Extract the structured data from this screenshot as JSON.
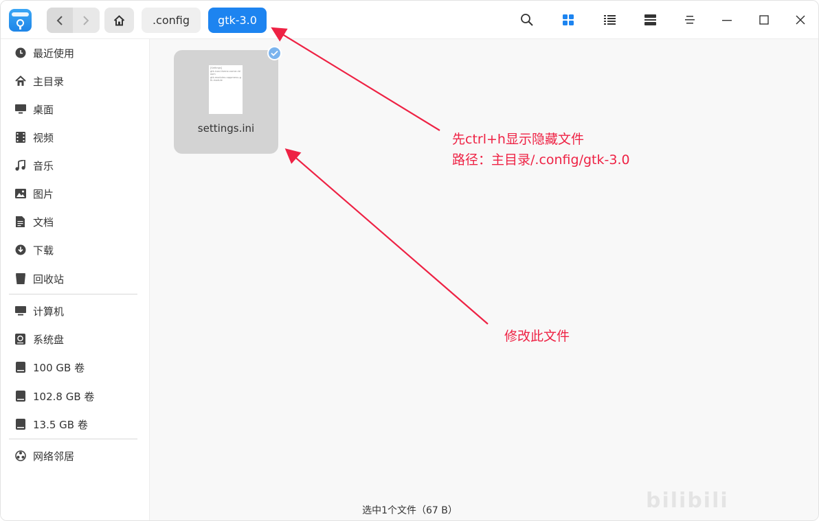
{
  "titlebar": {
    "nav": {
      "back_glyph": "‹",
      "forward_glyph": "›"
    },
    "breadcrumbs": [
      ".config",
      "gtk-3.0"
    ],
    "tools": {
      "search": "search-icon",
      "icon_view": "grid-view-icon",
      "list_view": "list-view-icon",
      "tree_view": "tree-view-icon",
      "menu": "menu-icon",
      "minimize": "minimize-icon",
      "maximize": "maximize-icon",
      "close": "close-icon"
    },
    "accent": "#1d84f0"
  },
  "sidebar": {
    "items": [
      {
        "label": "最近使用",
        "icon": "clock-icon"
      },
      {
        "label": "主目录",
        "icon": "home-icon"
      },
      {
        "label": "桌面",
        "icon": "desktop-icon"
      },
      {
        "label": "视频",
        "icon": "video-icon"
      },
      {
        "label": "音乐",
        "icon": "music-icon"
      },
      {
        "label": "图片",
        "icon": "picture-icon"
      },
      {
        "label": "文档",
        "icon": "document-icon"
      },
      {
        "label": "下载",
        "icon": "download-icon"
      },
      {
        "label": "回收站",
        "icon": "trash-icon"
      }
    ],
    "devices": [
      {
        "label": "计算机",
        "icon": "computer-icon"
      },
      {
        "label": "系统盘",
        "icon": "system-disk-icon"
      },
      {
        "label": "100 GB 卷",
        "icon": "drive-icon"
      },
      {
        "label": "102.8 GB 卷",
        "icon": "drive-icon"
      },
      {
        "label": "13.5 GB 卷",
        "icon": "drive-icon"
      }
    ],
    "network": [
      {
        "label": "网络邻居",
        "icon": "network-icon"
      }
    ]
  },
  "main": {
    "files": [
      {
        "name": "settings.ini",
        "thumb_lines": [
          "[Settings]",
          "gtk-icon-theme-name=bloom",
          "gtk-modules=appmenu-gtk-module"
        ],
        "selected": true
      }
    ]
  },
  "status": {
    "text": "选中1个文件（67 B）"
  },
  "annotations": {
    "color": "#ee2244",
    "note1_line1": "先ctrl+h显示隐藏文件",
    "note1_line2": "路径：主目录/.config/gtk-3.0",
    "note2": "修改此文件"
  },
  "watermark": {
    "text": "bilibili"
  }
}
